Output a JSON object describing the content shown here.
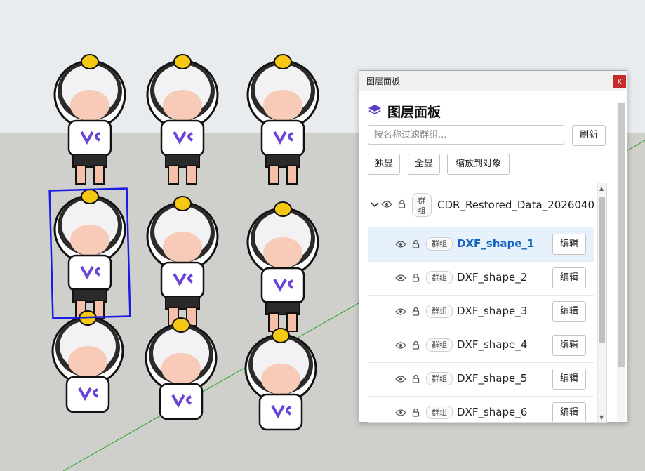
{
  "window": {
    "title": "图层面板",
    "close_label": "x"
  },
  "panel": {
    "heading": "图层面板",
    "filter_placeholder": "按名称过滤群组...",
    "filter_value": "",
    "refresh_label": "刷新",
    "solo_label": "独显",
    "show_all_label": "全显",
    "zoom_label": "缩放到对象"
  },
  "tree": {
    "parent": {
      "name": "CDR_Restored_Data_2026040",
      "badge": "群组",
      "expanded": true
    },
    "children": [
      {
        "name": "DXF_shape_1",
        "badge": "群组",
        "edit_label": "编辑",
        "selected": true
      },
      {
        "name": "DXF_shape_2",
        "badge": "群组",
        "edit_label": "编辑",
        "selected": false
      },
      {
        "name": "DXF_shape_3",
        "badge": "群组",
        "edit_label": "编辑",
        "selected": false
      },
      {
        "name": "DXF_shape_4",
        "badge": "群组",
        "edit_label": "编辑",
        "selected": false
      },
      {
        "name": "DXF_shape_5",
        "badge": "群组",
        "edit_label": "编辑",
        "selected": false
      },
      {
        "name": "DXF_shape_6",
        "badge": "群组",
        "edit_label": "编辑",
        "selected": false
      }
    ]
  },
  "icons": {
    "layers": "layers-icon",
    "eye": "eye-icon",
    "lock": "lock-icon",
    "chevron": "chevron-down-icon"
  },
  "colors": {
    "accent": "#1565c0",
    "selection_row": "#e7f1fb",
    "close": "#c42b2b",
    "selection_box": "#1a1ae6",
    "axis_green": "#2aa02a",
    "tshirt_logo": "#6a45d6"
  }
}
